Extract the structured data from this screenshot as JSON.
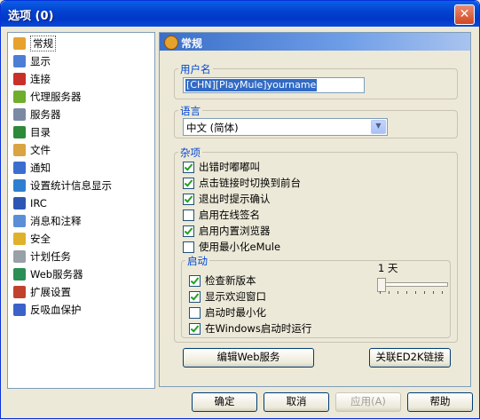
{
  "window": {
    "title": "选项 (0)",
    "close_label": "✕"
  },
  "sidebar": {
    "items": [
      {
        "label": "常规",
        "icon": "gear-icon",
        "color": "#e6a22d"
      },
      {
        "label": "显示",
        "icon": "display-icon",
        "color": "#4d7ed6"
      },
      {
        "label": "连接",
        "icon": "connection-icon",
        "color": "#c8312a"
      },
      {
        "label": "代理服务器",
        "icon": "proxy-icon",
        "color": "#6fae2c"
      },
      {
        "label": "服务器",
        "icon": "server-icon",
        "color": "#7a8aa3"
      },
      {
        "label": "目录",
        "icon": "folder-icon",
        "color": "#2d8a3a"
      },
      {
        "label": "文件",
        "icon": "file-icon",
        "color": "#d9a441"
      },
      {
        "label": "通知",
        "icon": "notification-icon",
        "color": "#3b6fcf"
      },
      {
        "label": "设置统计信息显示",
        "icon": "statistics-icon",
        "color": "#2f7fd1"
      },
      {
        "label": "IRC",
        "icon": "irc-icon",
        "color": "#2c56b3"
      },
      {
        "label": "消息和注释",
        "icon": "messages-icon",
        "color": "#5a8fd8"
      },
      {
        "label": "安全",
        "icon": "lock-icon",
        "color": "#e0b12a"
      },
      {
        "label": "计划任务",
        "icon": "schedule-icon",
        "color": "#9aa0a8"
      },
      {
        "label": "Web服务器",
        "icon": "globe-icon",
        "color": "#2a8f55"
      },
      {
        "label": "扩展设置",
        "icon": "extension-icon",
        "color": "#c2412d"
      },
      {
        "label": "反吸血保护",
        "icon": "shield-icon",
        "color": "#3a62c8"
      }
    ]
  },
  "panel": {
    "title": "常规",
    "username": {
      "label": "用户名",
      "value": "[CHN][PlayMule]yourname"
    },
    "language": {
      "label": "语言",
      "value": "中文 (简体)"
    },
    "misc": {
      "label": "杂项",
      "options": [
        {
          "label": "出错时嘟嘟叫",
          "checked": true
        },
        {
          "label": "点击链接时切换到前台",
          "checked": true
        },
        {
          "label": "退出时提示确认",
          "checked": true
        },
        {
          "label": "启用在线签名",
          "checked": false
        },
        {
          "label": "启用内置浏览器",
          "checked": true
        },
        {
          "label": "使用最小化eMule",
          "checked": false
        }
      ]
    },
    "startup": {
      "label": "启动",
      "interval_label": "1 天",
      "interval_days": 1,
      "options": [
        {
          "label": "检查新版本",
          "checked": true
        },
        {
          "label": "显示欢迎窗口",
          "checked": true
        },
        {
          "label": "启动时最小化",
          "checked": false
        },
        {
          "label": "在Windows启动时运行",
          "checked": true
        }
      ]
    },
    "edit_web_button": "编辑Web服务",
    "ed2k_button": "关联ED2K链接"
  },
  "footer": {
    "ok": "确定",
    "cancel": "取消",
    "apply": "应用(A)",
    "help": "帮助"
  }
}
